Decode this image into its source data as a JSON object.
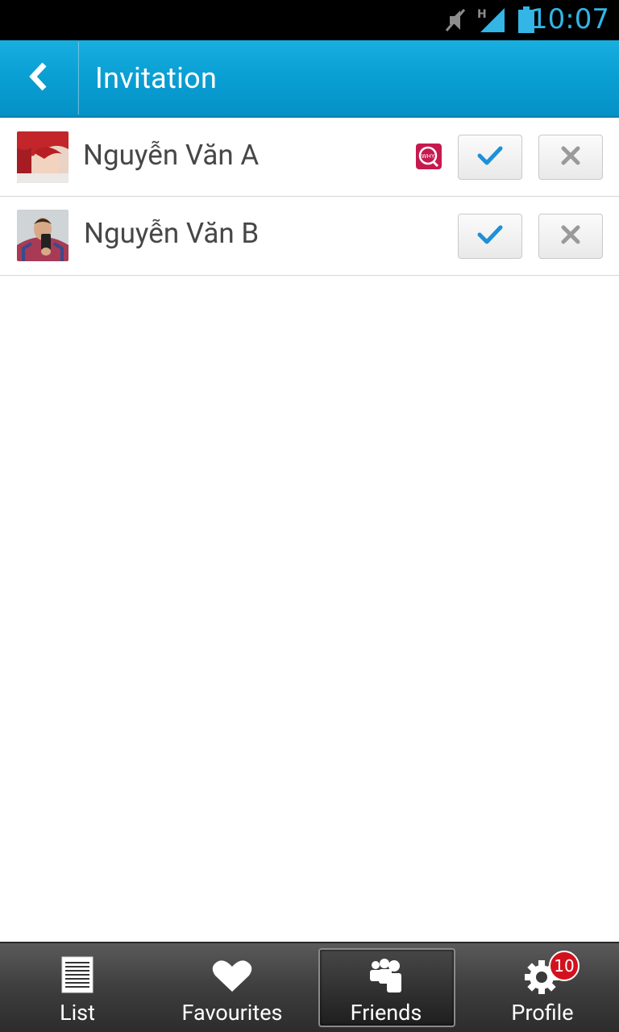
{
  "status_bar": {
    "time": "10:07",
    "icons": [
      "mute-icon",
      "signal-h-icon",
      "battery-icon"
    ]
  },
  "action_bar": {
    "back_icon": "chevron-left-icon",
    "title": "Invitation"
  },
  "invitations": [
    {
      "name": "Nguyễn Văn A",
      "has_why_badge": true
    },
    {
      "name": "Nguyễn Văn B",
      "has_why_badge": false
    }
  ],
  "tabs": [
    {
      "label": "List",
      "icon": "list-icon",
      "active": false
    },
    {
      "label": "Favourites",
      "icon": "heart-icon",
      "active": false
    },
    {
      "label": "Friends",
      "icon": "friends-icon",
      "active": true
    },
    {
      "label": "Profile",
      "icon": "gear-icon",
      "active": false,
      "badge": "10"
    }
  ],
  "colors": {
    "action_bar": "#0aa0d4",
    "accent": "#33b5e5",
    "check": "#1e90d6",
    "badge": "#d1121e"
  }
}
